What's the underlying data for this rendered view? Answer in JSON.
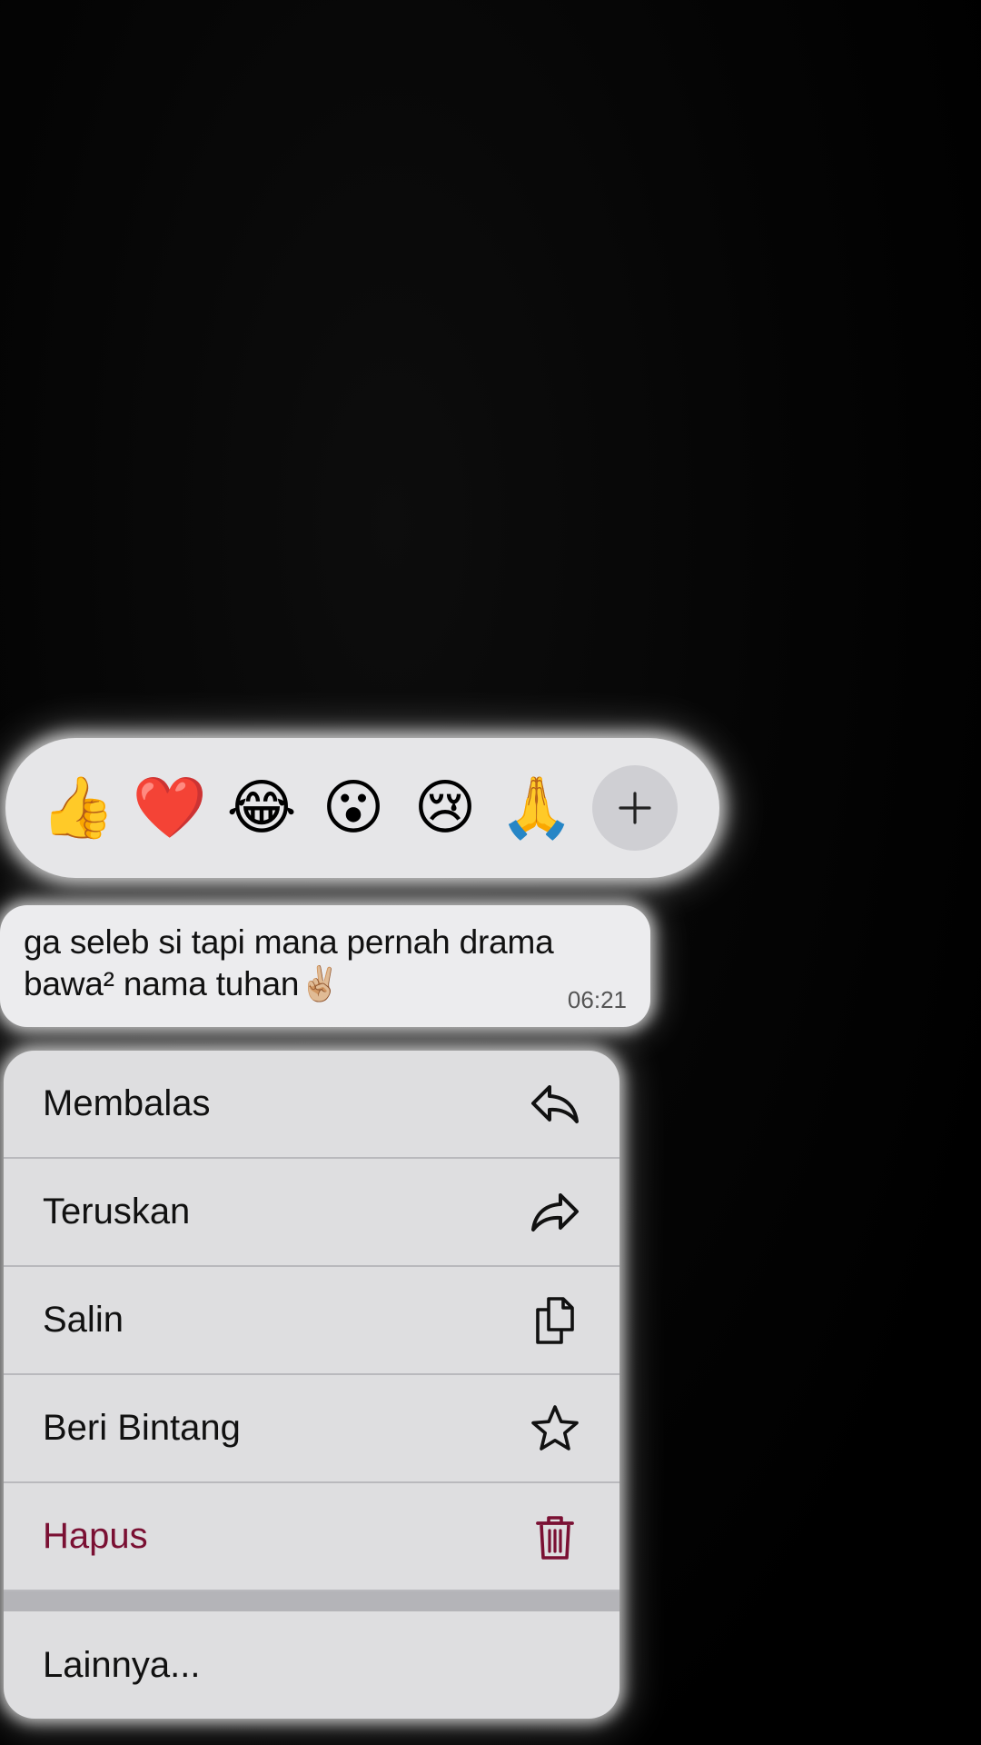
{
  "reactions": [
    {
      "emoji": "👍",
      "name": "thumbs-up"
    },
    {
      "emoji": "❤️",
      "name": "red-heart"
    },
    {
      "emoji": "😂",
      "name": "tears-of-joy"
    },
    {
      "emoji": "😮",
      "name": "open-mouth"
    },
    {
      "emoji": "😢",
      "name": "crying-face"
    },
    {
      "emoji": "🙏",
      "name": "folded-hands"
    }
  ],
  "reaction_more_label": "+",
  "message": {
    "line1": "ga seleb si tapi mana pernah drama",
    "line2": "bawa² nama tuhan✌🏼",
    "time": "06:21"
  },
  "menu": {
    "items": [
      {
        "label": "Membalas",
        "icon": "reply-icon"
      },
      {
        "label": "Teruskan",
        "icon": "forward-icon"
      },
      {
        "label": "Salin",
        "icon": "copy-icon"
      },
      {
        "label": "Beri Bintang",
        "icon": "star-icon"
      },
      {
        "label": "Hapus",
        "icon": "trash-icon"
      }
    ],
    "more_label": "Lainnya..."
  },
  "colors": {
    "destructive": "#7a1033",
    "menu_bg": "#dedee0",
    "glow": "#ffffff"
  }
}
